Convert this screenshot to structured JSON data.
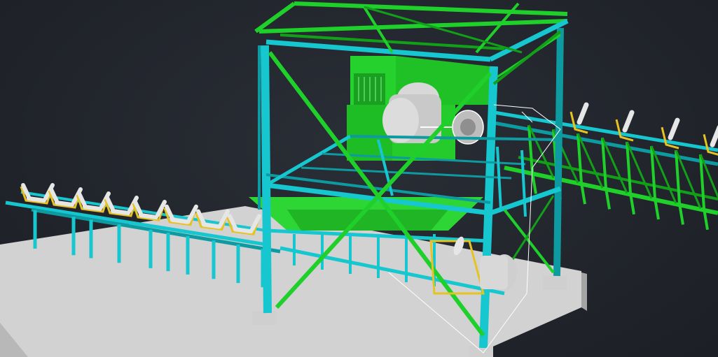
{
  "viewport": {
    "background": "#22252c"
  },
  "model": {
    "colors": {
      "steel": "#16c7cf",
      "steel_dark": "#0e9aa1",
      "bracing": "#1fd02a",
      "bracing_dark": "#12a019",
      "equipment": "#25d12c",
      "equipment_dark": "#149a18",
      "idler_frame": "#e6c322",
      "roller": "#e6e6e6",
      "roller_shade": "#a9a9a9",
      "foundation_top": "#d2d2d2",
      "foundation_side": "#a4a4a4",
      "plinth": "#cfcfcf"
    },
    "components": [
      "concrete-foundation",
      "tower-frame",
      "cross-bracing",
      "crusher-housing",
      "drive-motor",
      "left-conveyor",
      "right-conveyor-truss",
      "return-idlers"
    ]
  }
}
